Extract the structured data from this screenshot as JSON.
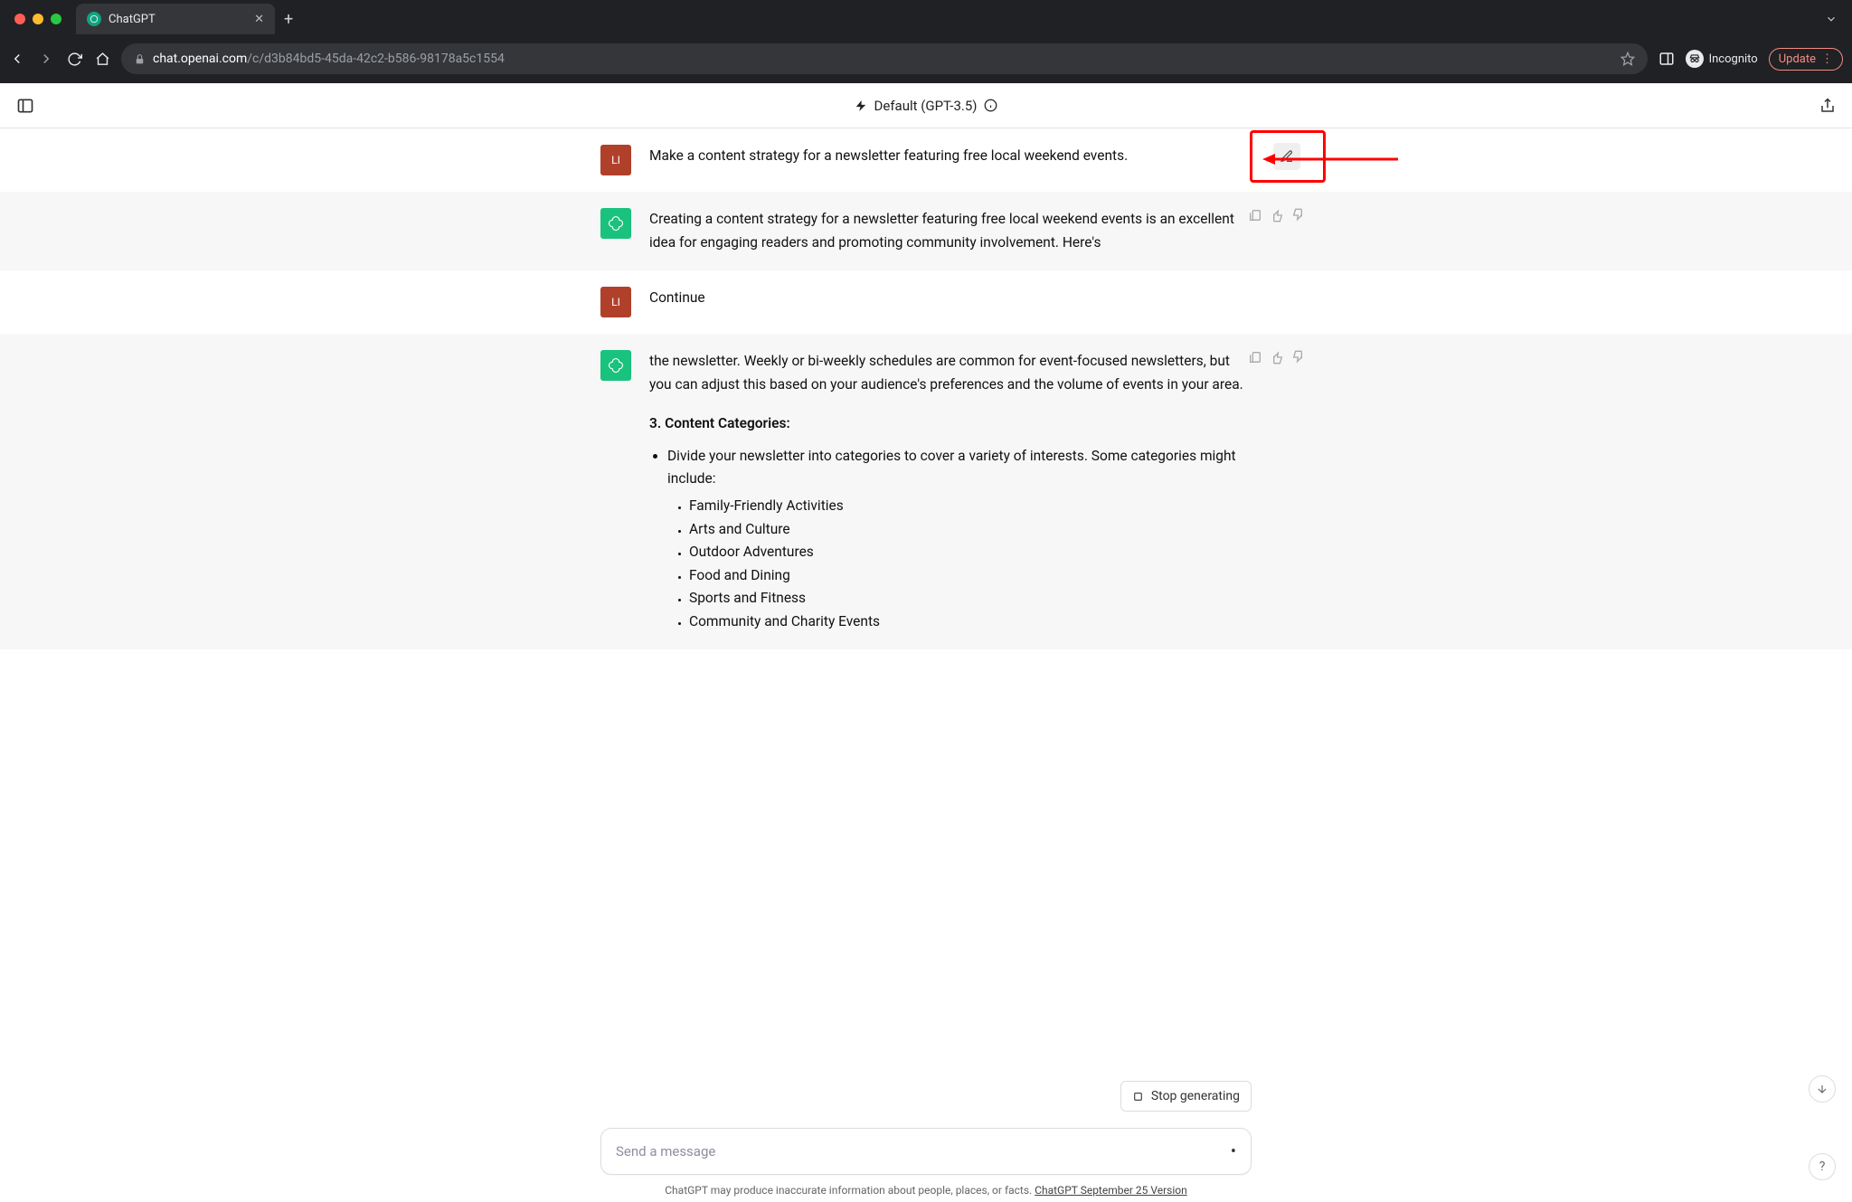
{
  "browser": {
    "tab_title": "ChatGPT",
    "url_domain": "chat.openai.com",
    "url_path": "/c/d3b84bd5-45da-42c2-b586-98178a5c1554",
    "incognito_label": "Incognito",
    "update_label": "Update"
  },
  "header": {
    "model_label": "Default (GPT-3.5)"
  },
  "messages": {
    "user_initials": "LI",
    "user1": "Make a content strategy for a newsletter featuring free local weekend events.",
    "assistant1": "Creating a content strategy for a newsletter featuring free local weekend events is an excellent idea for engaging readers and promoting community involvement. Here's",
    "user2": "Continue",
    "assistant2_intro": "the newsletter. Weekly or bi-weekly schedules are common for event-focused newsletters, but you can adjust this based on your audience's preferences and the volume of events in your area.",
    "assistant2_heading": "3. Content Categories:",
    "assistant2_bullet": "Divide your newsletter into categories to cover a variety of interests. Some categories might include:",
    "categories": {
      "c0": "Family-Friendly Activities",
      "c1": "Arts and Culture",
      "c2": "Outdoor Adventures",
      "c3": "Food and Dining",
      "c4": "Sports and Fitness",
      "c5": "Community and Charity Events"
    }
  },
  "controls": {
    "stop_label": "Stop generating",
    "composer_placeholder": "Send a message"
  },
  "footer": {
    "text_prefix": "ChatGPT may produce inaccurate information about people, places, or facts. ",
    "link_text": "ChatGPT September 25 Version"
  }
}
